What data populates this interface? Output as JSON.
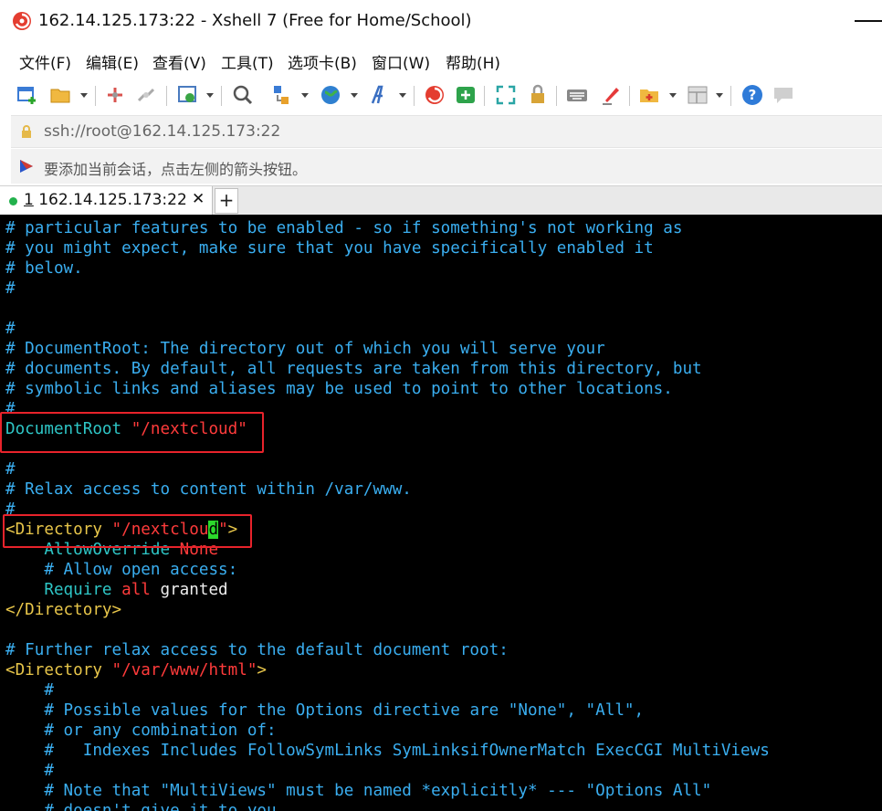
{
  "window": {
    "title": "162.14.125.173:22 - Xshell 7 (Free for Home/School)",
    "app_icon": "xshell-logo-icon"
  },
  "menu": {
    "items": [
      "文件(F)",
      "编辑(E)",
      "查看(V)",
      "工具(T)",
      "选项卡(B)",
      "窗口(W)",
      "帮助(H)"
    ]
  },
  "toolbar": {
    "icons": [
      "new-session-icon",
      "open-folder-icon",
      "reconnect-icon",
      "disconnect-icon",
      "properties-icon",
      "find-icon",
      "transfer-icon",
      "globe-icon",
      "font-icon",
      "xshell-icon",
      "xftp-icon",
      "fullscreen-icon",
      "lock-icon",
      "keyboard-icon",
      "highlight-icon",
      "add-icon",
      "layout-icon",
      "help-icon",
      "chat-icon"
    ]
  },
  "address": {
    "value": "ssh://root@162.14.125.173:22"
  },
  "hint": {
    "text": "要添加当前会话，点击左侧的箭头按钮。"
  },
  "tabs": [
    {
      "number": "1",
      "label": "162.14.125.173:22",
      "close": "✕",
      "active": true
    }
  ],
  "new_tab_label": "+",
  "colors": {
    "comment": "#3aaef0",
    "directive": "#2ec6c6",
    "string": "#ff3b3b",
    "tag": "#e8c64a",
    "cursor": "#2bd92b",
    "highlight_box": "#e8232b"
  },
  "terminal": {
    "l1": "# particular features to be enabled - so if something's not working as",
    "l2": "# you might expect, make sure that you have specifically enabled it",
    "l3": "# below.",
    "l4": "#",
    "l5": "#",
    "l6": "# DocumentRoot: The directory out of which you will serve your",
    "l7": "# documents. By default, all requests are taken from this directory, but",
    "l8": "# symbolic links and aliases may be used to point to other locations.",
    "l9": "#",
    "doc_root_directive": "DocumentRoot",
    "doc_root_value": "\"/nextcloud\"",
    "l11": "#",
    "l12": "# Relax access to content within /var/www.",
    "l13": "#",
    "dir1_open": "<Directory",
    "dir1_value_a": "\"/nextclou",
    "dir1_cursor": "d",
    "dir1_value_b": "\"",
    "dir1_close": ">",
    "allow_override": "AllowOverride",
    "allow_override_value": "None",
    "allow_comment": "# Allow open access:",
    "require": "Require",
    "require_all": "all",
    "require_granted": "granted",
    "dir1_end": "</Directory>",
    "l20": "# Further relax access to the default document root:",
    "dir2_open": "<Directory",
    "dir2_value": "\"/var/www/html\"",
    "dir2_close": ">",
    "l22": "#",
    "l23": "# Possible values for the Options directive are \"None\", \"All\",",
    "l24": "# or any combination of:",
    "l25": "#   Indexes Includes FollowSymLinks SymLinksifOwnerMatch ExecCGI MultiViews",
    "l26": "#",
    "l27": "# Note that \"MultiViews\" must be named *explicitly* --- \"Options All\"",
    "l28": "# doesn't give it to you."
  }
}
